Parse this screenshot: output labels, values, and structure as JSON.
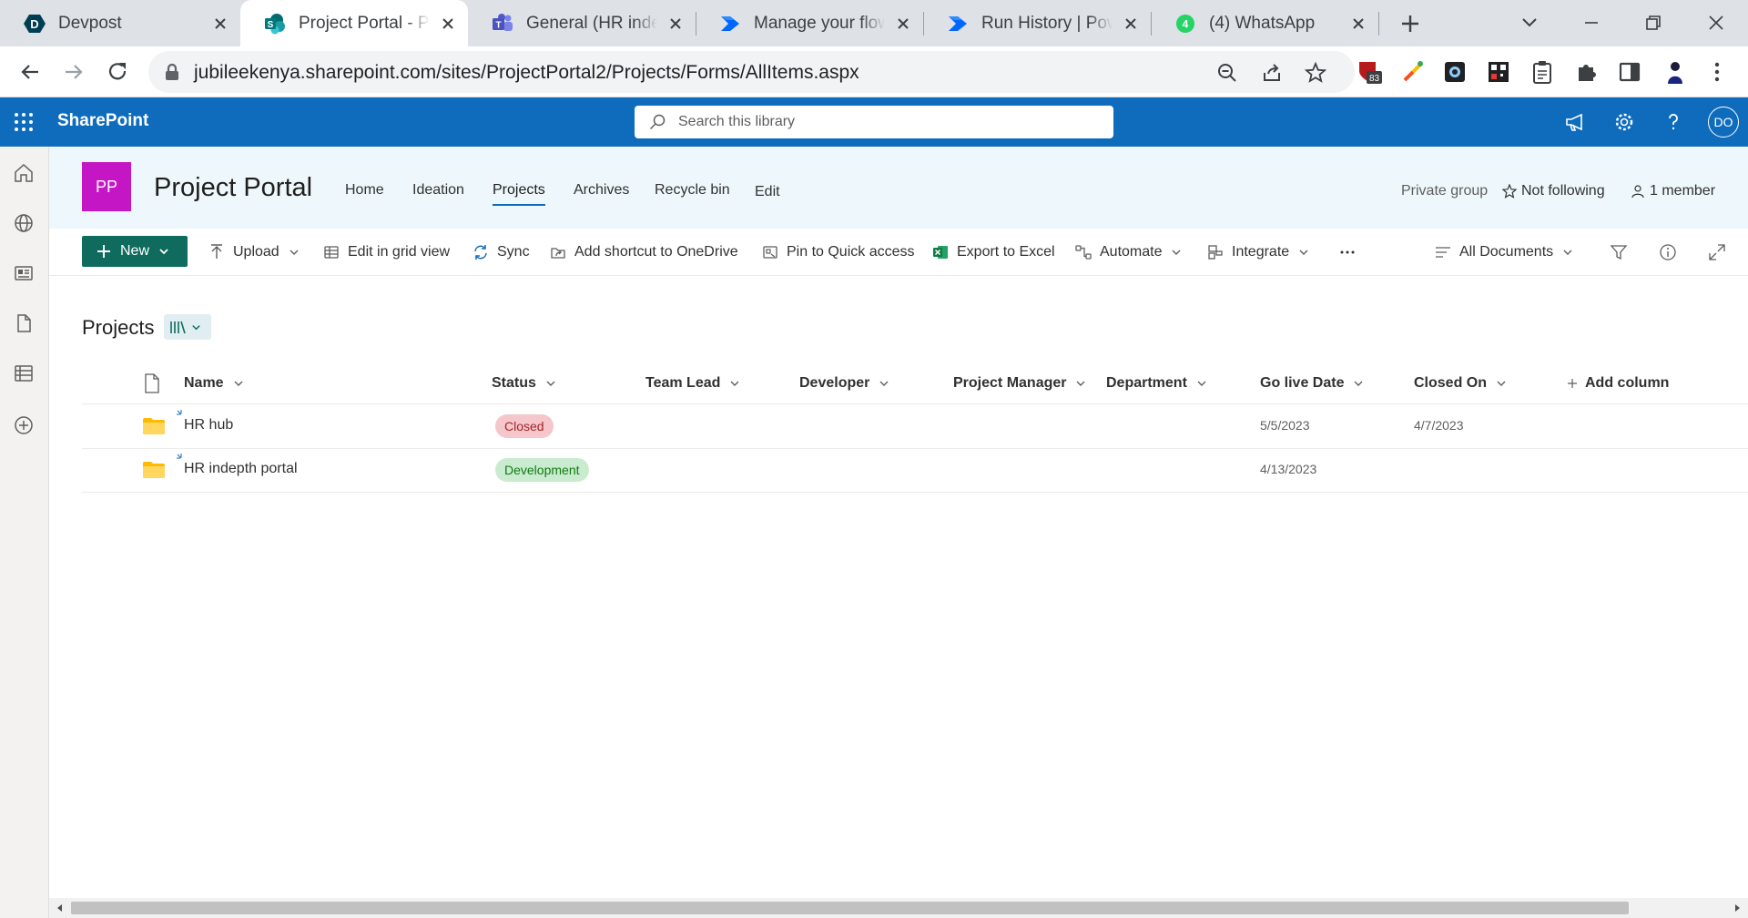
{
  "browser": {
    "tabs": [
      {
        "title": "Devpost",
        "icon": "devpost-icon"
      },
      {
        "title": "Project Portal - Projects - All Documents",
        "icon": "sharepoint-icon"
      },
      {
        "title": "General (HR indepth portal) | Microsoft Teams",
        "icon": "teams-icon"
      },
      {
        "title": "Manage your flows | Power Automate",
        "icon": "power-automate-icon"
      },
      {
        "title": "Run History | Power Automate",
        "icon": "power-automate-icon"
      },
      {
        "title": "(4) WhatsApp",
        "icon": "whatsapp-icon"
      }
    ],
    "active_tab_index": 1,
    "url": "jubileekenya.sharepoint.com/sites/ProjectPortal2/Projects/Forms/AllItems.aspx",
    "extension_badge": "83",
    "whatsapp_badge": "4"
  },
  "suite": {
    "brand": "SharePoint",
    "search_placeholder": "Search this library",
    "avatar_initials": "DO"
  },
  "site": {
    "logo_initials": "PP",
    "logo_color": "#c516c5",
    "title": "Project Portal",
    "nav": [
      "Home",
      "Ideation",
      "Projects",
      "Archives",
      "Recycle bin",
      "Edit"
    ],
    "active_nav": "Projects",
    "privacy": "Private group",
    "follow": "Not following",
    "members": "1 member"
  },
  "commands": {
    "new": "New",
    "upload": "Upload",
    "grid": "Edit in grid view",
    "sync": "Sync",
    "shortcut": "Add shortcut to OneDrive",
    "pin": "Pin to Quick access",
    "export": "Export to Excel",
    "automate": "Automate",
    "integrate": "Integrate",
    "view": "All Documents"
  },
  "library": {
    "title": "Projects",
    "columns": [
      "Name",
      "Status",
      "Team Lead",
      "Developer",
      "Project Manager",
      "Department",
      "Go live Date",
      "Closed On"
    ],
    "add_column": "Add column",
    "rows": [
      {
        "name": "HR hub",
        "status": "Closed",
        "team_lead": "",
        "developer": "",
        "project_manager": "",
        "department": "",
        "go_live": "5/5/2023",
        "closed_on": "4/7/2023"
      },
      {
        "name": "HR indepth portal",
        "status": "Development",
        "team_lead": "",
        "developer": "",
        "project_manager": "",
        "department": "",
        "go_live": "4/13/2023",
        "closed_on": ""
      }
    ]
  },
  "colors": {
    "suite_bar": "#0f6cbd",
    "new_button": "#0e6b5e",
    "status_closed_bg": "#f5c6cb",
    "status_dev_bg": "#c9ebcf"
  }
}
